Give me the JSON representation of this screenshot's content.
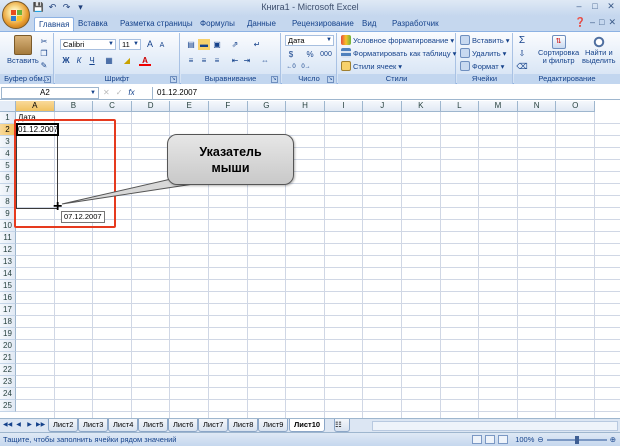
{
  "window": {
    "title": "Книга1 - Microsoft Excel"
  },
  "qat": [
    "save-icon",
    "undo-icon",
    "redo-icon",
    "customize-icon"
  ],
  "tabs": [
    "Главная",
    "Вставка",
    "Разметка страницы",
    "Формулы",
    "Данные",
    "Рецензирование",
    "Вид",
    "Разработчик"
  ],
  "ribbon": {
    "clipboard": {
      "paste": "Вставить",
      "label": "Буфер обм..."
    },
    "font": {
      "name": "Calibri",
      "size": "11",
      "bold": "Ж",
      "italic": "К",
      "underline": "Ч",
      "grow": "A",
      "shrink": "A",
      "font_color": "A",
      "label": "Шрифт"
    },
    "alignment": {
      "label": "Выравнивание"
    },
    "number": {
      "format": "Дата",
      "currency": "$",
      "percent": "%",
      "thousands": "000",
      "label": "Число"
    },
    "styles": {
      "conditional": "Условное форматирование",
      "as_table": "Форматировать как таблицу",
      "cell_styles": "Стили ячеек",
      "label": "Стили"
    },
    "cells": {
      "insert": "Вставить",
      "delete": "Удалить",
      "format": "Формат",
      "label": "Ячейки"
    },
    "editing": {
      "sort_line1": "Сортировка",
      "sort_line2": "и фильтр",
      "find_line1": "Найти и",
      "find_line2": "выделить",
      "label": "Редактирование"
    }
  },
  "formula_bar": {
    "name_box": "A2",
    "fx": "fx",
    "value": "01.12.2007"
  },
  "columns": [
    "A",
    "B",
    "C",
    "D",
    "E",
    "F",
    "G",
    "H",
    "I",
    "J",
    "K",
    "L",
    "M",
    "N",
    "O"
  ],
  "rows": [
    "1",
    "2",
    "3",
    "4",
    "5",
    "6",
    "7",
    "8",
    "9",
    "10",
    "11",
    "12",
    "13",
    "14",
    "15",
    "16",
    "17",
    "18",
    "19",
    "20",
    "21",
    "22",
    "23",
    "24",
    "25"
  ],
  "cells": {
    "A1": "Дата",
    "A2": "01.12.2007"
  },
  "fill_tooltip": "07.12.2007",
  "callout": {
    "line1": "Указатель",
    "line2": "мыши"
  },
  "sheets": [
    "Лист2",
    "Лист3",
    "Лист4",
    "Лист5",
    "Лист6",
    "Лист7",
    "Лист8",
    "Лист9",
    "Лист10"
  ],
  "active_sheet": "Лист10",
  "status": {
    "message": "Тащите, чтобы заполнить ячейки рядом значений",
    "zoom": "100%"
  },
  "colors": {
    "accent": "#15428b",
    "highlight_frame": "#e63a1e",
    "selected_header": "#f1c15f"
  }
}
